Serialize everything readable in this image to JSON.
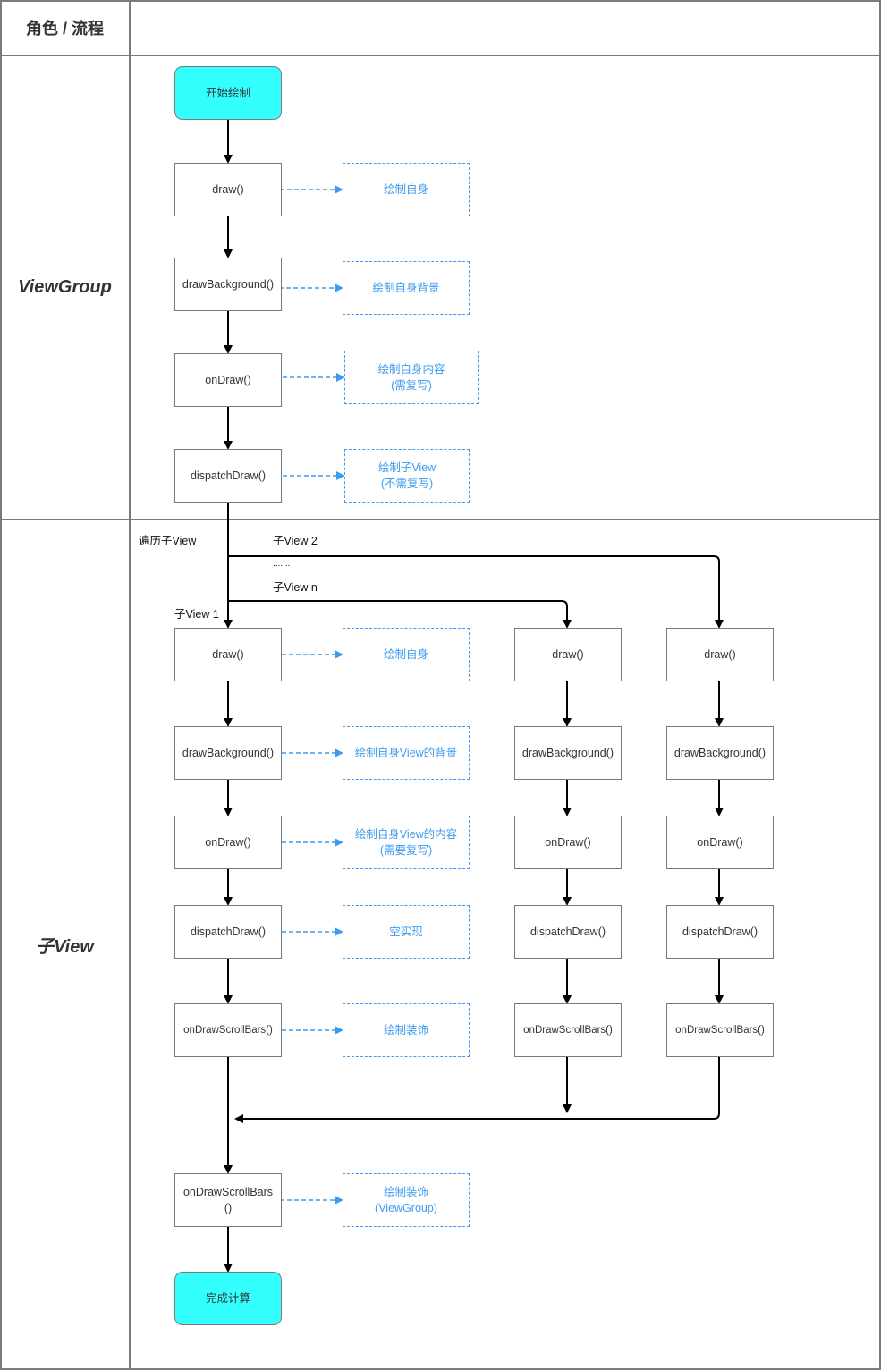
{
  "header": {
    "title": "角色 / 流程"
  },
  "lanes": [
    {
      "id": "viewgroup",
      "label": "ViewGroup"
    },
    {
      "id": "child",
      "label": "子View"
    }
  ],
  "viewgroup_flow": {
    "start": "开始绘制",
    "steps": [
      {
        "method": "draw()",
        "note": "绘制自身"
      },
      {
        "method": "drawBackground()",
        "note": "绘制自身背景"
      },
      {
        "method": "onDraw()",
        "note": "绘制自身内容\n(需复写)"
      },
      {
        "method": "dispatchDraw()",
        "note": "绘制子View\n(不需复写)"
      }
    ]
  },
  "child_flow": {
    "traverse_label": "遍历子View",
    "branch_labels": [
      "子View 1",
      "子View 2",
      ".......",
      "子View n"
    ],
    "child1_steps": [
      {
        "method": "draw()",
        "note": "绘制自身"
      },
      {
        "method": "drawBackground()",
        "note": "绘制自身View的背景"
      },
      {
        "method": "onDraw()",
        "note": "绘制自身View的内容\n(需要复写)"
      },
      {
        "method": "dispatchDraw()",
        "note": "空实现"
      },
      {
        "method": "onDrawScrollBars()",
        "note": "绘制装饰"
      }
    ],
    "childn_steps": [
      "draw()",
      "drawBackground()",
      "onDraw()",
      "dispatchDraw()",
      "onDrawScrollBars()"
    ],
    "child2_steps": [
      "draw()",
      "drawBackground()",
      "onDraw()",
      "dispatchDraw()",
      "onDrawScrollBars()"
    ],
    "final_step": {
      "method": "onDrawScrollBars\n()",
      "note": "绘制装饰\n(ViewGroup)"
    },
    "end": "完成计算"
  },
  "colors": {
    "terminal_fill": "#33ffff",
    "note_accent": "#3d9bef",
    "grid_line": "#7a7a7a",
    "flow_line": "#000000"
  }
}
